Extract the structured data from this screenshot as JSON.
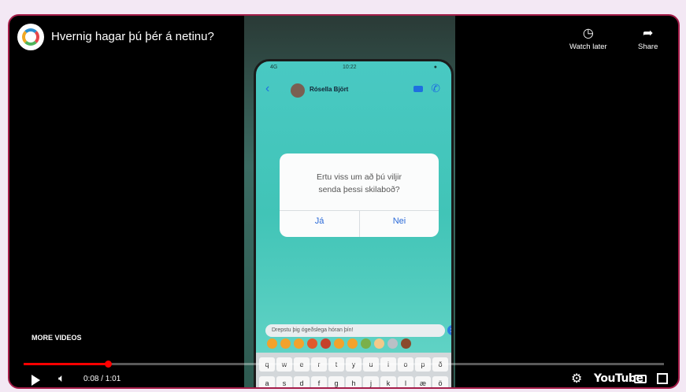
{
  "video": {
    "title": "Hvernig hagar þú þér á netinu?",
    "more_videos_label": "MORE VIDEOS",
    "time_display": "0:08 / 1:01",
    "progress_fraction": 0.131
  },
  "top_controls": {
    "watch_later_label": "Watch later",
    "share_label": "Share"
  },
  "bottom_controls": {
    "youtube_logo_text": "YouTube"
  },
  "phone": {
    "status_left": "4G",
    "status_time": "10:22",
    "status_right": "●",
    "contact_name": "Rósella Björt",
    "dialog_text": "Ertu viss um að þú viljir senda þessi skilaboð?",
    "dialog_yes": "Já",
    "dialog_no": "Nei",
    "message_input_text": "Drepstu þig ógeðslega hóran þín!",
    "keyboard_row1": [
      "q",
      "w",
      "e",
      "r",
      "t",
      "y",
      "u",
      "i",
      "o",
      "p",
      "ð"
    ],
    "keyboard_row2": [
      "a",
      "s",
      "d",
      "f",
      "g",
      "h",
      "j",
      "k",
      "l",
      "æ",
      "ö"
    ]
  },
  "colors": {
    "frame_border": "#a51e4a",
    "progress": "#ff0000",
    "phone_bg": "#45c6be",
    "accent_blue": "#2b6ad8"
  }
}
